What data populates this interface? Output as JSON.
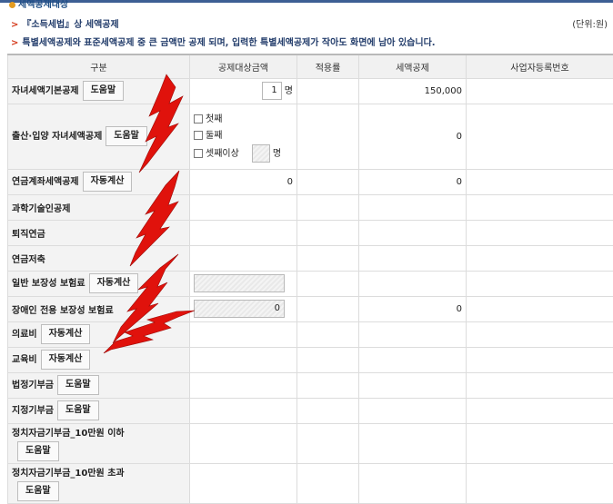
{
  "section": {
    "title": "세액공제대상",
    "line1": "『소득세법』상 세액공제",
    "unit": "(단위:원)",
    "line2": "특별세액공제와 표준세액공제 중 큰 금액만 공제 되며, 입력한 특별세액공제가 작아도 화면에 남아 있습니다."
  },
  "table": {
    "headers": [
      "구분",
      "공제대상금액",
      "적용률",
      "세액공제",
      "사업자등록번호"
    ],
    "rows": {
      "child_basic": {
        "label": "자녀세액기본공제",
        "button": "도움말",
        "count_value": "1",
        "count_unit": "명",
        "credit": "150,000"
      },
      "birth": {
        "label": "출산·입양 자녀세액공제",
        "button": "도움말",
        "opt1": "첫째",
        "opt2": "둘째",
        "opt3": "셋째이상",
        "opt3_unit": "명",
        "credit": "0"
      },
      "pension": {
        "label": "연금계좌세액공제",
        "button": "자동계산",
        "amount": "0",
        "credit": "0"
      },
      "science": {
        "label": "과학기술인공제"
      },
      "retire": {
        "label": "퇴직연금"
      },
      "savings": {
        "label": "연금저축"
      },
      "insurance": {
        "label": "일반 보장성 보험료",
        "button": "자동계산"
      },
      "disabled_ins": {
        "label": "장애인 전용 보장성 보험료",
        "amount": "0",
        "credit": "0"
      },
      "medical": {
        "label": "의료비",
        "button": "자동계산"
      },
      "education": {
        "label": "교육비",
        "button": "자동계산"
      },
      "legal_donation": {
        "label": "법정기부금",
        "button": "도움말"
      },
      "designated_donation": {
        "label": "지정기부금",
        "button": "도움말"
      },
      "political_under": {
        "label": "정치자금기부금_10만원 이하",
        "button": "도움말"
      },
      "political_over": {
        "label": "정치자금기부금_10만원 초과",
        "button": "도움말"
      }
    }
  },
  "colors": {
    "accent": "#1f4f86",
    "arrow": "#e0120c",
    "header_bg": "#f1f1f1"
  }
}
